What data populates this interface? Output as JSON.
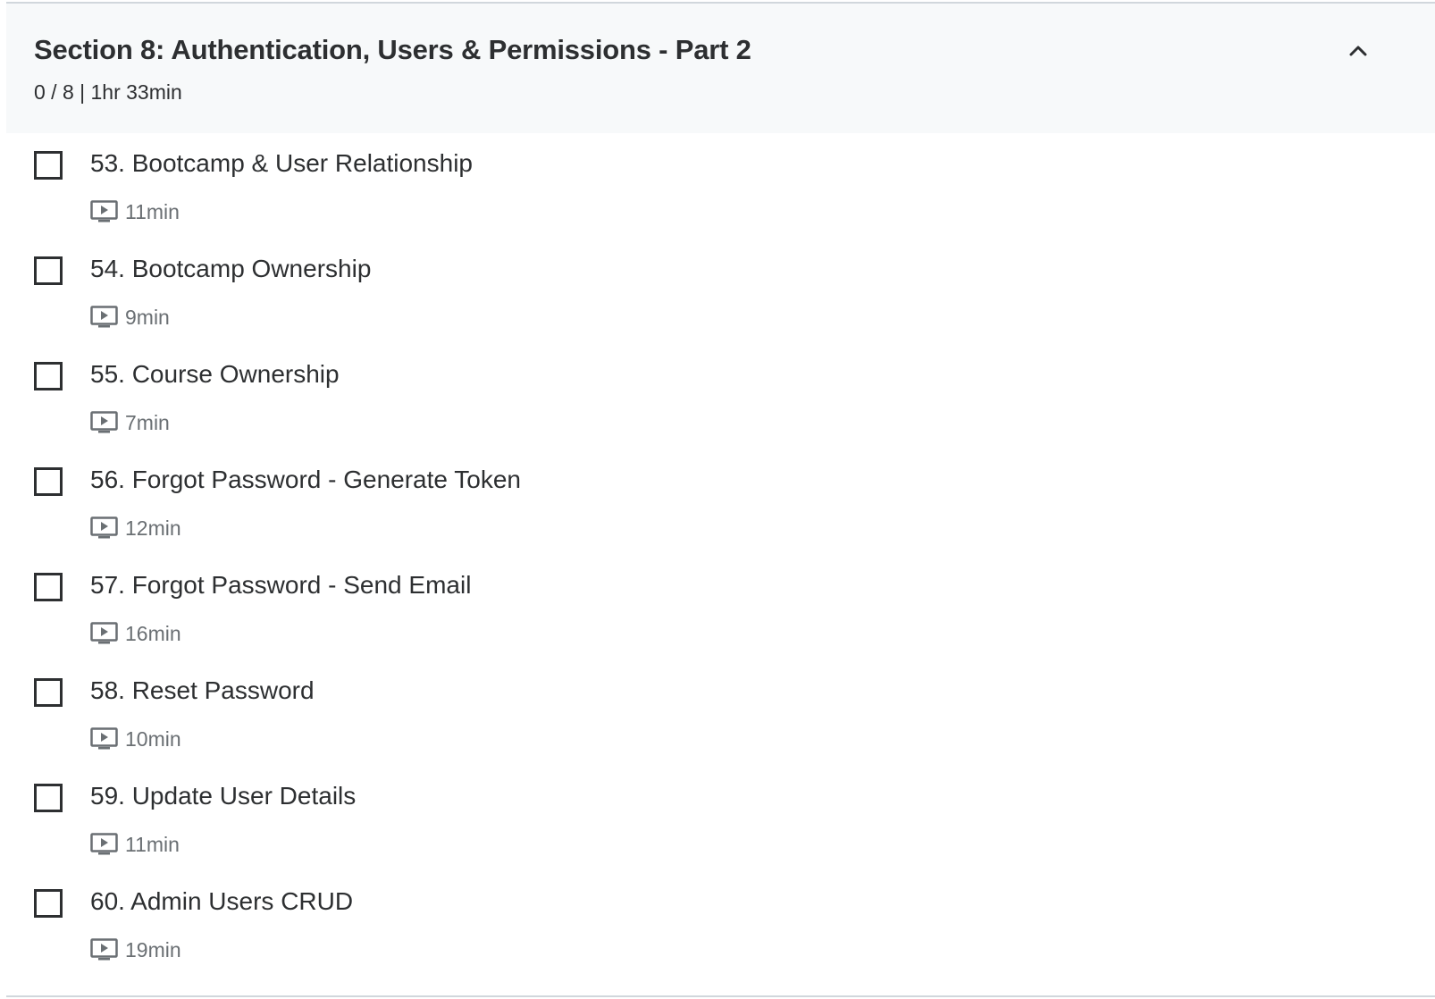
{
  "section": {
    "title": "Section 8: Authentication, Users & Permissions - Part 2",
    "meta": "0 / 8 | 1hr 33min",
    "collapse_icon": "chevron-up-icon"
  },
  "lessons": [
    {
      "title": "53. Bootcamp & User Relationship",
      "duration": "11min",
      "completed": false,
      "icon": "video-icon"
    },
    {
      "title": "54. Bootcamp Ownership",
      "duration": "9min",
      "completed": false,
      "icon": "video-icon"
    },
    {
      "title": "55. Course Ownership",
      "duration": "7min",
      "completed": false,
      "icon": "video-icon"
    },
    {
      "title": "56. Forgot Password - Generate Token",
      "duration": "12min",
      "completed": false,
      "icon": "video-icon"
    },
    {
      "title": "57. Forgot Password - Send Email",
      "duration": "16min",
      "completed": false,
      "icon": "video-icon"
    },
    {
      "title": "58. Reset Password",
      "duration": "10min",
      "completed": false,
      "icon": "video-icon"
    },
    {
      "title": "59. Update User Details",
      "duration": "11min",
      "completed": false,
      "icon": "video-icon"
    },
    {
      "title": "60. Admin Users CRUD",
      "duration": "19min",
      "completed": false,
      "icon": "video-icon"
    }
  ],
  "colors": {
    "header_bg": "#f7f9fa",
    "text": "#2d2f31",
    "muted": "#6a6f73",
    "border": "#d1d7dc"
  }
}
